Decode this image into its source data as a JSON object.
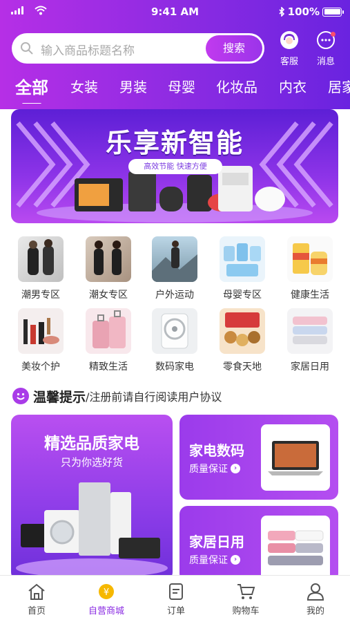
{
  "status_bar": {
    "time": "9:41 AM",
    "battery": "100%",
    "battery_level": 1.0
  },
  "search": {
    "placeholder": "输入商品标题名称",
    "button_label": "搜索"
  },
  "header_icons": {
    "service_label": "客服",
    "messages_label": "消息"
  },
  "categories": [
    "全部",
    "女装",
    "男装",
    "母婴",
    "化妆品",
    "内衣",
    "居家"
  ],
  "banner": {
    "title": "乐享新智能",
    "subtitle": "高效节能 快速方便"
  },
  "grid": [
    {
      "label": "潮男专区",
      "icon": "menswear-photo"
    },
    {
      "label": "潮女专区",
      "icon": "womenswear-photo"
    },
    {
      "label": "户外运动",
      "icon": "outdoor-photo"
    },
    {
      "label": "母婴专区",
      "icon": "baby-photo"
    },
    {
      "label": "健康生活",
      "icon": "health-photo"
    },
    {
      "label": "美妆个护",
      "icon": "cosmetics-photo"
    },
    {
      "label": "精致生活",
      "icon": "luggage-photo"
    },
    {
      "label": "数码家电",
      "icon": "appliance-photo"
    },
    {
      "label": "零食天地",
      "icon": "snacks-photo"
    },
    {
      "label": "家居日用",
      "icon": "towels-photo"
    }
  ],
  "tip": {
    "title": "温馨提示",
    "text": "/注册前请自行阅读用户协议"
  },
  "promo_left": {
    "title": "精选品质家电",
    "subtitle": "只为你选好货"
  },
  "promo_right": [
    {
      "title": "家电数码",
      "subtitle": "质量保证",
      "icon": "laptop-photo"
    },
    {
      "title": "家居日用",
      "subtitle": "质量保证",
      "icon": "towels-photo"
    }
  ],
  "tabbar": [
    {
      "label": "首页",
      "icon": "home-icon"
    },
    {
      "label": "自营商城",
      "icon": "coin-icon"
    },
    {
      "label": "订单",
      "icon": "order-icon"
    },
    {
      "label": "购物车",
      "icon": "cart-icon"
    },
    {
      "label": "我的",
      "icon": "user-icon"
    }
  ],
  "colors": {
    "accent": "#8a2be2",
    "header_start": "#b62fe6",
    "header_end": "#6a23e0"
  }
}
